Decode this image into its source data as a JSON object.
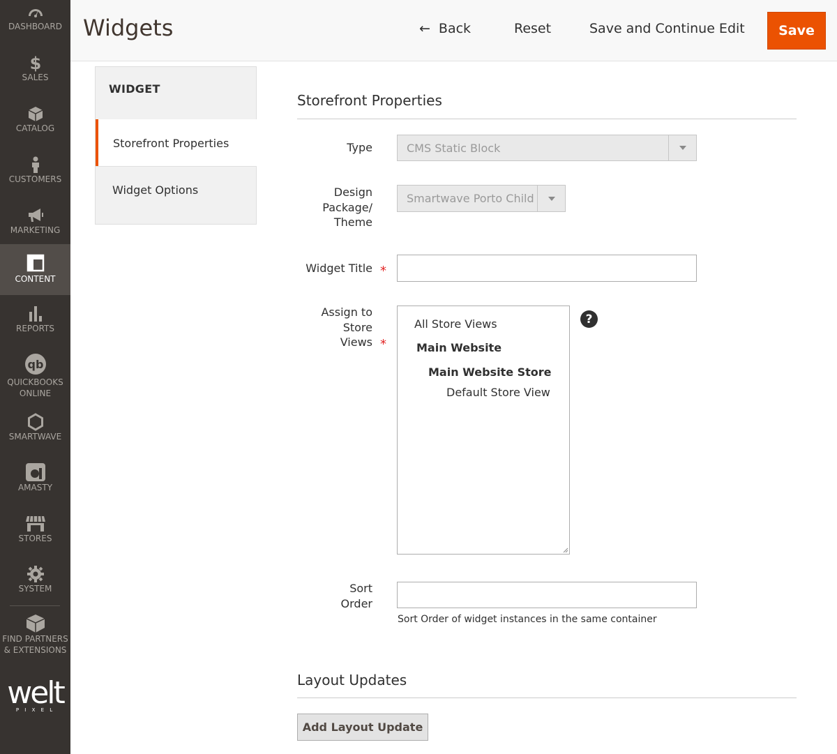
{
  "sidebar": {
    "items": [
      {
        "label": "DASHBOARD",
        "icon": "dashboard-icon"
      },
      {
        "label": "SALES",
        "icon": "dollar-icon"
      },
      {
        "label": "CATALOG",
        "icon": "box-icon"
      },
      {
        "label": "CUSTOMERS",
        "icon": "person-icon"
      },
      {
        "label": "MARKETING",
        "icon": "megaphone-icon"
      },
      {
        "label": "CONTENT",
        "icon": "layout-icon"
      },
      {
        "label": "REPORTS",
        "icon": "bar-chart-icon"
      },
      {
        "label": "QUICKBOOKS",
        "label2": "ONLINE",
        "icon": "quickbooks-icon"
      },
      {
        "label": "SMARTWAVE",
        "icon": "hexagon-icon"
      },
      {
        "label": "AMASTY",
        "icon": "amasty-icon"
      },
      {
        "label": "STORES",
        "icon": "storefront-icon"
      },
      {
        "label": "SYSTEM",
        "icon": "gear-icon"
      },
      {
        "label": "FIND PARTNERS",
        "label2": "& EXTENSIONS",
        "icon": "extensions-icon"
      }
    ],
    "logo_text": "welt",
    "logo_sub": "P I X E L"
  },
  "header": {
    "title": "Widgets",
    "back_label": "Back",
    "reset_label": "Reset",
    "save_continue_label": "Save and Continue Edit",
    "save_label": "Save"
  },
  "tabs": {
    "title": "WIDGET",
    "items": [
      {
        "label": "Storefront Properties"
      },
      {
        "label": "Widget Options"
      }
    ]
  },
  "storefront": {
    "title": "Storefront Properties",
    "type_label": "Type",
    "type_value": "CMS Static Block",
    "design_label_1": "Design",
    "design_label_2": "Package/",
    "design_label_3": "Theme",
    "design_value": "Smartwave Porto Child",
    "widget_title_label": "Widget Title",
    "widget_title_value": "",
    "assign_label_1": "Assign to",
    "assign_label_2": "Store",
    "assign_label_3": "Views",
    "store_views": [
      {
        "label": "All Store Views",
        "bold": false
      },
      {
        "label": "Main Website",
        "bold": true
      },
      {
        "label": "Main Website Store",
        "bold": true
      },
      {
        "label": "Default Store View",
        "bold": false
      }
    ],
    "help_symbol": "?",
    "sort_label_1": "Sort",
    "sort_label_2": "Order",
    "sort_value": "",
    "sort_note": "Sort Order of widget instances in the same container"
  },
  "layout": {
    "title": "Layout Updates",
    "add_button_label": "Add Layout Update"
  },
  "colors": {
    "accent": "#eb5202",
    "sidebar_bg": "#373330",
    "required": "#e22626"
  }
}
